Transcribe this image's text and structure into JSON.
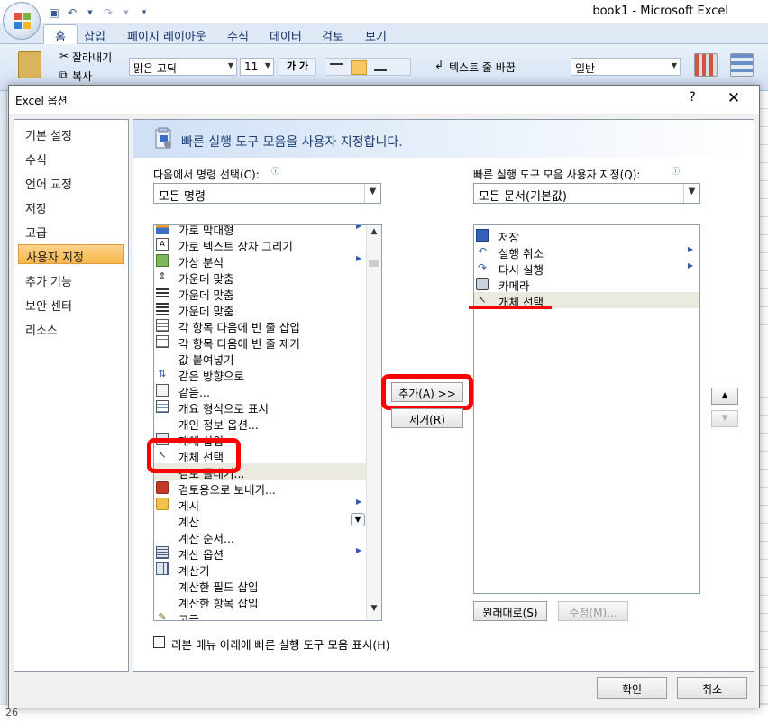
{
  "excel": {
    "app_title": "book1 - Microsoft Excel",
    "ribbon_tabs": [
      "홈",
      "삽입",
      "페이지 레이아웃",
      "수식",
      "데이터",
      "검토",
      "보기"
    ],
    "clipboard": {
      "cut": "잘라내기",
      "copy": "복사"
    },
    "font_name": "맑은 고딕",
    "font_size": "11",
    "wrap_text": "텍스트 줄 바꿈",
    "number_format": "일반",
    "row_number_bottom": "26"
  },
  "dialog": {
    "title": "Excel 옵션",
    "help": "?",
    "close": "✕",
    "nav": [
      "기본 설정",
      "수식",
      "언어 교정",
      "저장",
      "고급",
      "사용자 지정",
      "추가 기능",
      "보안 센터",
      "리소스"
    ],
    "nav_active_index": 5,
    "banner_title": "빠른 실행 도구 모음을 사용자 지정합니다.",
    "left_label": "다음에서 명령 선택(C):",
    "left_combo": "모든 명령",
    "right_label": "빠른 실행 도구 모음 사용자 지정(Q):",
    "right_combo": "모든 문서(기본값)",
    "commands": [
      "가로 막대형",
      "가로 텍스트 상자 그리기",
      "가상 분석",
      "가운데 맞춤",
      "가운데 맞춤",
      "가운데 맞춤",
      "각 항목 다음에 빈 줄 삽입",
      "각 항목 다음에 빈 줄 제거",
      "값 붙여넣기",
      "같은 방향으로",
      "같음...",
      "개요 형식으로 표시",
      "개인 정보 옵션...",
      "개체 삽입",
      "개체 선택",
      "검토 플래기...",
      "검토용으로 보내기...",
      "게시",
      "계산",
      "계산 순서...",
      "계산 옵션",
      "계산기",
      "계산한 필드 삽입",
      "계산한 항목 삽입",
      "고급..."
    ],
    "commands_selected_index": 15,
    "qat_items": [
      "저장",
      "실행 취소",
      "다시 실행",
      "카메라",
      "개체 선택"
    ],
    "qat_selected_index": 4,
    "add_button": "추가(A) >>",
    "remove_button": "제거(R)",
    "reset_button": "원래대로(S)",
    "modify_button": "수정(M)...",
    "checkbox_label": "리본 메뉴 아래에 빠른 실행 도구 모음 표시(H)",
    "ok_button": "확인",
    "cancel_button": "취소"
  },
  "colors": {
    "highlight": "#ff0000",
    "nav_active": "#f9b84b",
    "banner": "#cfe0f5"
  }
}
